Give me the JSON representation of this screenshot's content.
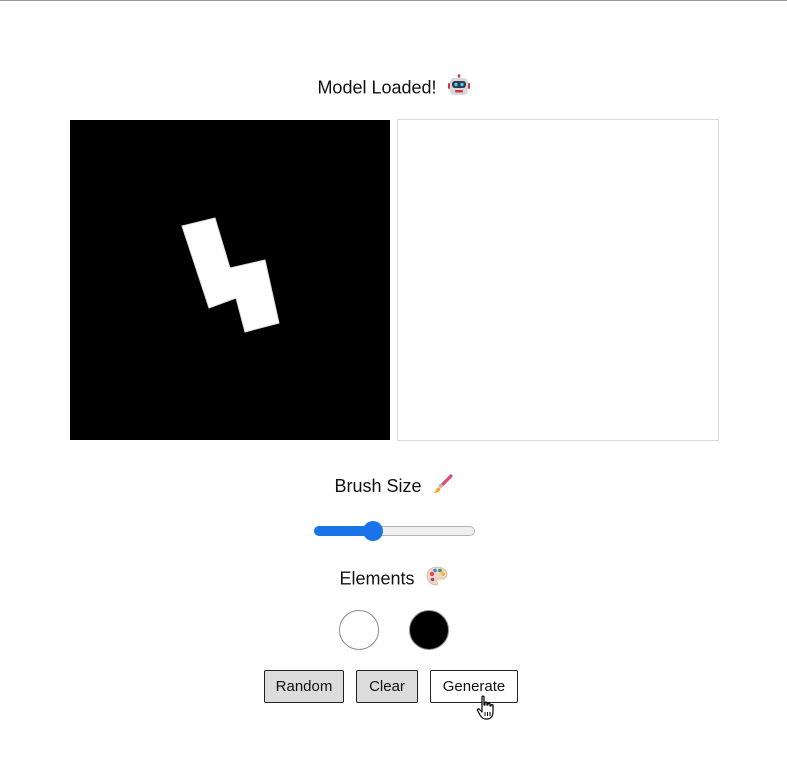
{
  "header": {
    "status_text": "Model Loaded!",
    "status_icon": "robot-icon"
  },
  "canvases": {
    "input_background": "#000000",
    "output_background": "#ffffff",
    "stroke_color": "#ffffff"
  },
  "brush": {
    "label": "Brush Size",
    "icon": "paintbrush-icon",
    "value": 0.35,
    "accent_color": "#1a73e8"
  },
  "elements": {
    "label": "Elements",
    "icon": "palette-icon",
    "swatches": [
      {
        "name": "white",
        "color": "#ffffff"
      },
      {
        "name": "black",
        "color": "#000000"
      }
    ]
  },
  "buttons": {
    "random_label": "Random",
    "clear_label": "Clear",
    "generate_label": "Generate"
  }
}
